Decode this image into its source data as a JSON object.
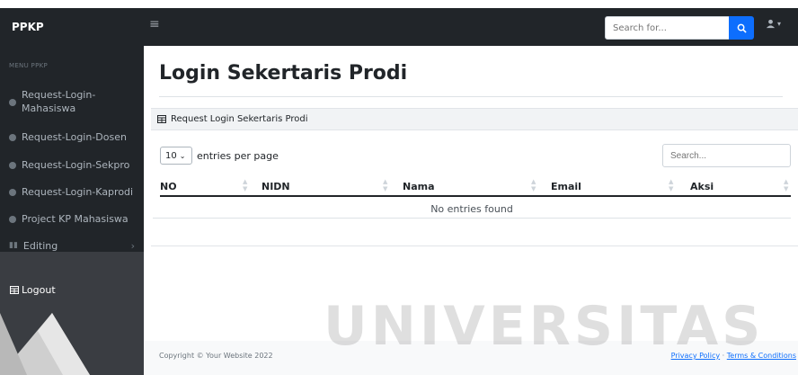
{
  "navbar": {
    "brand": "PPKP",
    "toggle_icon": "bars-icon",
    "search_placeholder": "Search for...",
    "search_icon": "search-icon",
    "user_icon": "user-icon"
  },
  "sidebar": {
    "heading": "MENU PPKP",
    "items": [
      {
        "label": "Request-Login-Mahasiswa"
      },
      {
        "label": "Request-Login-Dosen"
      },
      {
        "label": "Request-Login-Sekpro"
      },
      {
        "label": "Request-Login-Kaprodi"
      },
      {
        "label": "Project KP Mahasiswa"
      },
      {
        "label": "Editing"
      }
    ],
    "logout": "Logout"
  },
  "main": {
    "title": "Login Sekertaris Prodi",
    "card_title": "Request Login Sekertaris Prodi",
    "entries_value": "10",
    "entries_label": "entries per page",
    "search_placeholder": "Search...",
    "columns": [
      "NO",
      "NIDN",
      "Nama",
      "Email",
      "Aksi"
    ],
    "empty_message": "No entries found"
  },
  "footer": {
    "copyright": "Copyright © Your Website 2022",
    "privacy": "Privacy Policy",
    "separator": "·",
    "terms": "Terms & Conditions"
  },
  "watermark": "UNIVERSITAS",
  "colors": {
    "navbar_bg": "#212529",
    "primary": "#0d6efd",
    "accent_red": "#e0282e"
  }
}
